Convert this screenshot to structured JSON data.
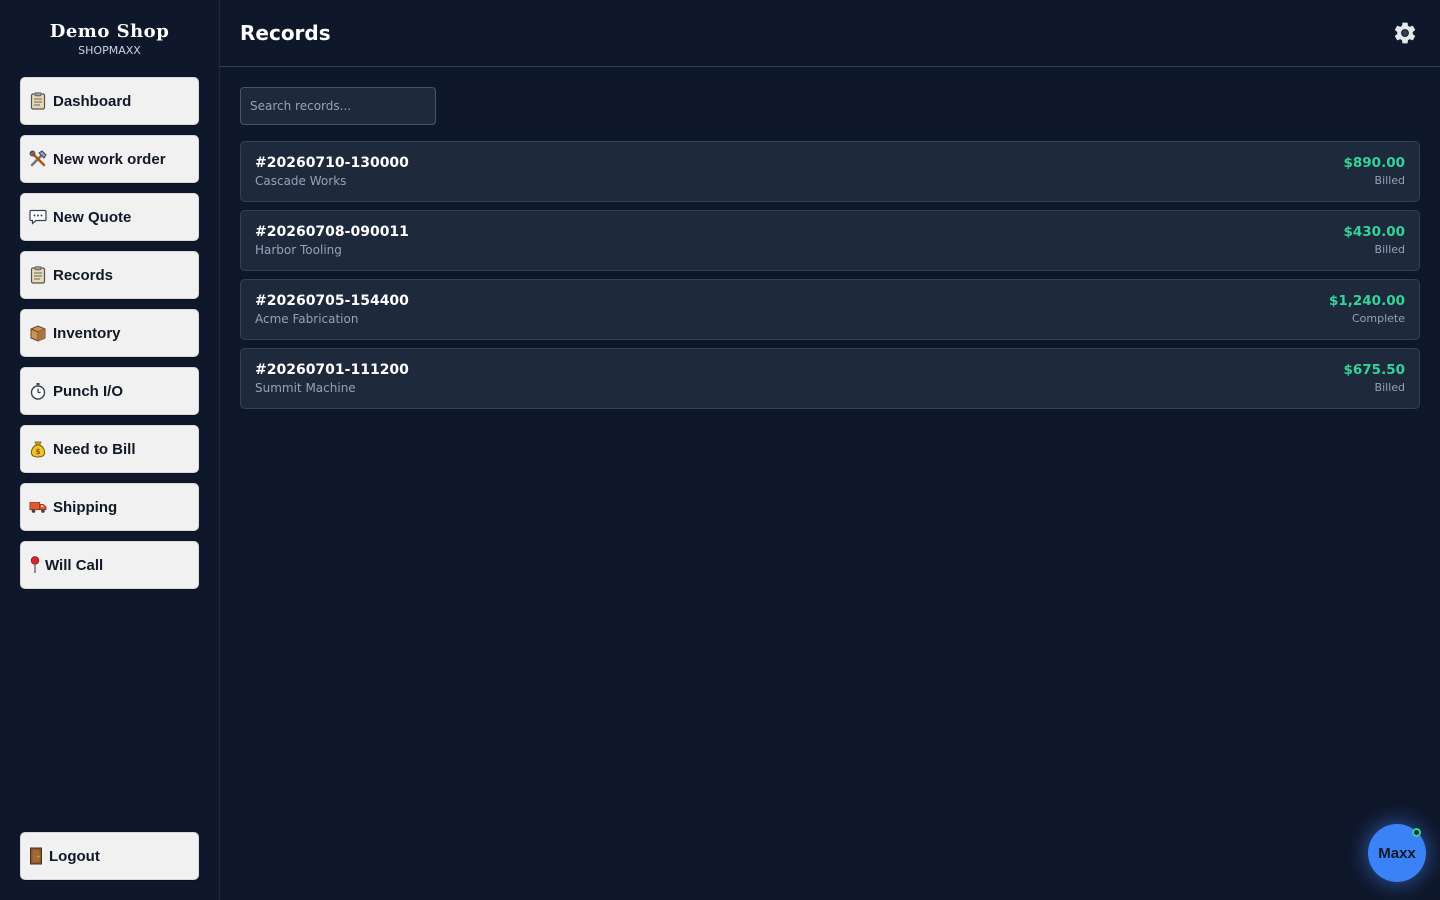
{
  "brand": {
    "name": "Demo Shop",
    "subtitle": "SHOPMAXX"
  },
  "sidebar": {
    "items": [
      {
        "label": "Dashboard",
        "icon": "clipboard-icon"
      },
      {
        "label": "New work order",
        "icon": "tools-icon"
      },
      {
        "label": "New Quote",
        "icon": "speech-bubble-icon"
      },
      {
        "label": "Records",
        "icon": "clipboard-icon"
      },
      {
        "label": "Inventory",
        "icon": "package-icon"
      },
      {
        "label": "Punch I/O",
        "icon": "stopwatch-icon"
      },
      {
        "label": "Need to Bill",
        "icon": "money-bag-icon"
      },
      {
        "label": "Shipping",
        "icon": "truck-icon"
      },
      {
        "label": "Will Call",
        "icon": "pin-icon"
      }
    ],
    "logout": {
      "label": "Logout",
      "icon": "door-icon"
    }
  },
  "header": {
    "title": "Records",
    "settings_icon": "gear-icon"
  },
  "search": {
    "placeholder": "Search records...",
    "value": ""
  },
  "records": [
    {
      "id": "#20260710-130000",
      "customer": "Cascade Works",
      "amount": "$890.00",
      "status": "Billed"
    },
    {
      "id": "#20260708-090011",
      "customer": "Harbor Tooling",
      "amount": "$430.00",
      "status": "Billed"
    },
    {
      "id": "#20260705-154400",
      "customer": "Acme Fabrication",
      "amount": "$1,240.00",
      "status": "Complete"
    },
    {
      "id": "#20260701-111200",
      "customer": "Summit Machine",
      "amount": "$675.50",
      "status": "Billed"
    }
  ],
  "assistant": {
    "label": "Maxx"
  },
  "colors": {
    "background": "#0f172a",
    "card": "#1e293b",
    "amount": "#34d399",
    "assistant": "#3b82f6"
  }
}
